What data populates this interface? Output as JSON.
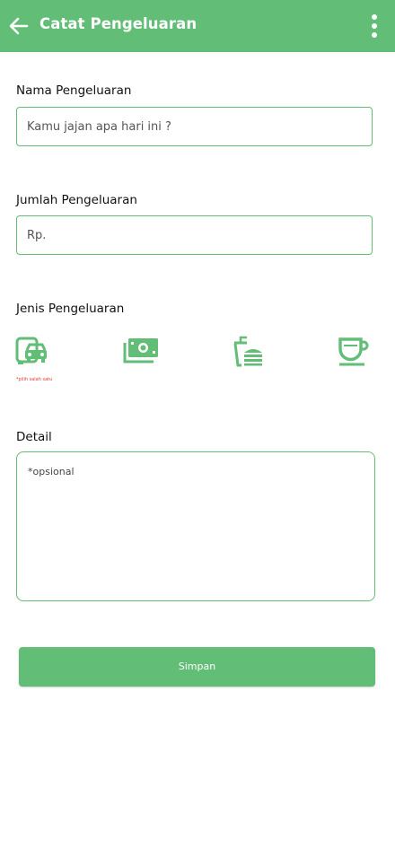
{
  "appbar": {
    "title": "Catat Pengeluaran",
    "back_icon": "arrow-left-icon",
    "menu_icon": "more-vertical-icon",
    "color": "#62bd77"
  },
  "form": {
    "name": {
      "label": "Nama Pengeluaran",
      "placeholder": "Kamu jajan apa hari ini ?"
    },
    "amount": {
      "label": "Jumlah Pengeluaran",
      "placeholder": "Rp."
    },
    "type": {
      "label": "Jenis Pengeluaran",
      "hint": "*pilih salah satu",
      "hint_color": "#e53935",
      "options": [
        {
          "icon": "transport-icon"
        },
        {
          "icon": "money-icon"
        },
        {
          "icon": "fast-food-icon"
        },
        {
          "icon": "coffee-cup-icon"
        }
      ]
    },
    "detail": {
      "label": "Detail",
      "placeholder": "*opsional"
    },
    "submit_label": "Simpan"
  }
}
